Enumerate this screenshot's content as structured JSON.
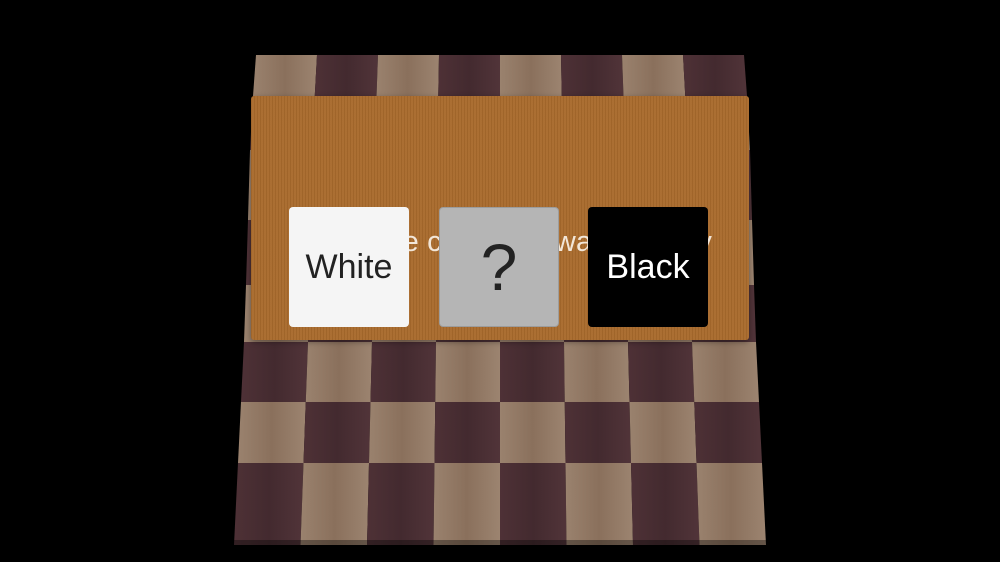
{
  "dialog": {
    "title": "Select the color you want to play",
    "options": [
      {
        "label": "White",
        "background": "#f5f5f5",
        "text_color": "#222222"
      },
      {
        "label": "?",
        "background": "#b5b5b5",
        "text_color": "#222222"
      },
      {
        "label": "Black",
        "background": "#000000",
        "text_color": "#ffffff"
      }
    ],
    "panel_color": "#a86a2c"
  },
  "board": {
    "light_square_color": "#8f7763",
    "dark_square_color": "#4a2f34",
    "background_color": "#000000"
  }
}
